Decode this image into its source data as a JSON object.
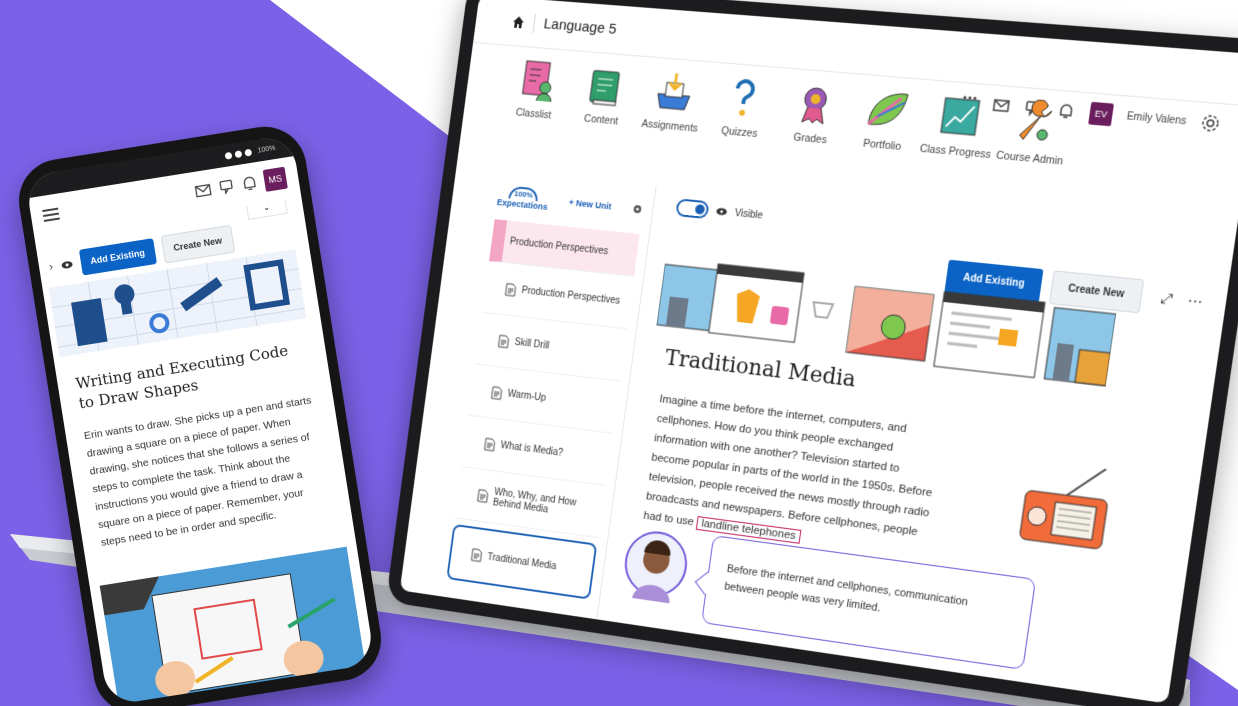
{
  "laptop": {
    "breadcrumb_title": "Language 5",
    "user_initials": "EV",
    "user_name": "Emily Valens",
    "tools": [
      {
        "label": "Classlist",
        "icon": "classlist-icon"
      },
      {
        "label": "Content",
        "icon": "content-icon"
      },
      {
        "label": "Assignments",
        "icon": "assignments-icon"
      },
      {
        "label": "Quizzes",
        "icon": "quizzes-icon"
      },
      {
        "label": "Grades",
        "icon": "grades-icon"
      },
      {
        "label": "Portfolio",
        "icon": "portfolio-icon"
      },
      {
        "label": "Class Progress",
        "icon": "class-progress-icon"
      },
      {
        "label": "Course Admin",
        "icon": "course-admin-icon"
      }
    ],
    "sidebar": {
      "expectations_pct": "100%",
      "expectations_label": "Expectations",
      "new_unit": "+ New Unit",
      "items": [
        {
          "label": "Production Perspectives"
        },
        {
          "label": "Production Perspectives"
        },
        {
          "label": "Skill Drill"
        },
        {
          "label": "Warm-Up"
        },
        {
          "label": "What is Media?"
        },
        {
          "label": "Who, Why, and How Behind Media"
        },
        {
          "label": "Traditional Media"
        }
      ]
    },
    "main": {
      "visible_label": "Visible",
      "add_existing": "Add Existing",
      "create_new": "Create New",
      "lesson_title": "Traditional Media",
      "body_text": "Imagine a time before the internet, computers, and cellphones. How do you think people exchanged information with one another? Television started to become popular in parts of the world in the 1950s. Before television, people received the news mostly through radio broadcasts and newspapers. Before cellphones, people had to use",
      "highlight_text": "landline telephones",
      "speech_text": "Before the internet and cellphones, communication between people was very limited."
    }
  },
  "phone": {
    "status_battery": "100%",
    "user_initials": "MS",
    "add_existing": "Add Existing",
    "create_new": "Create New",
    "lesson_title": "Writing and Executing Code to Draw Shapes",
    "body_text": "Erin wants to draw. She picks up a pen and starts drawing a square on a piece of paper. When drawing, she notices that she follows a series of steps to complete the task. Think about the instructions you would give a friend to draw a square on a piece of paper. Remember, your steps need to be in order and specific."
  },
  "colors": {
    "purple_bg": "#7b61e8",
    "primary_blue": "#0b63c5",
    "avatar_purple": "#6b1e5e"
  }
}
